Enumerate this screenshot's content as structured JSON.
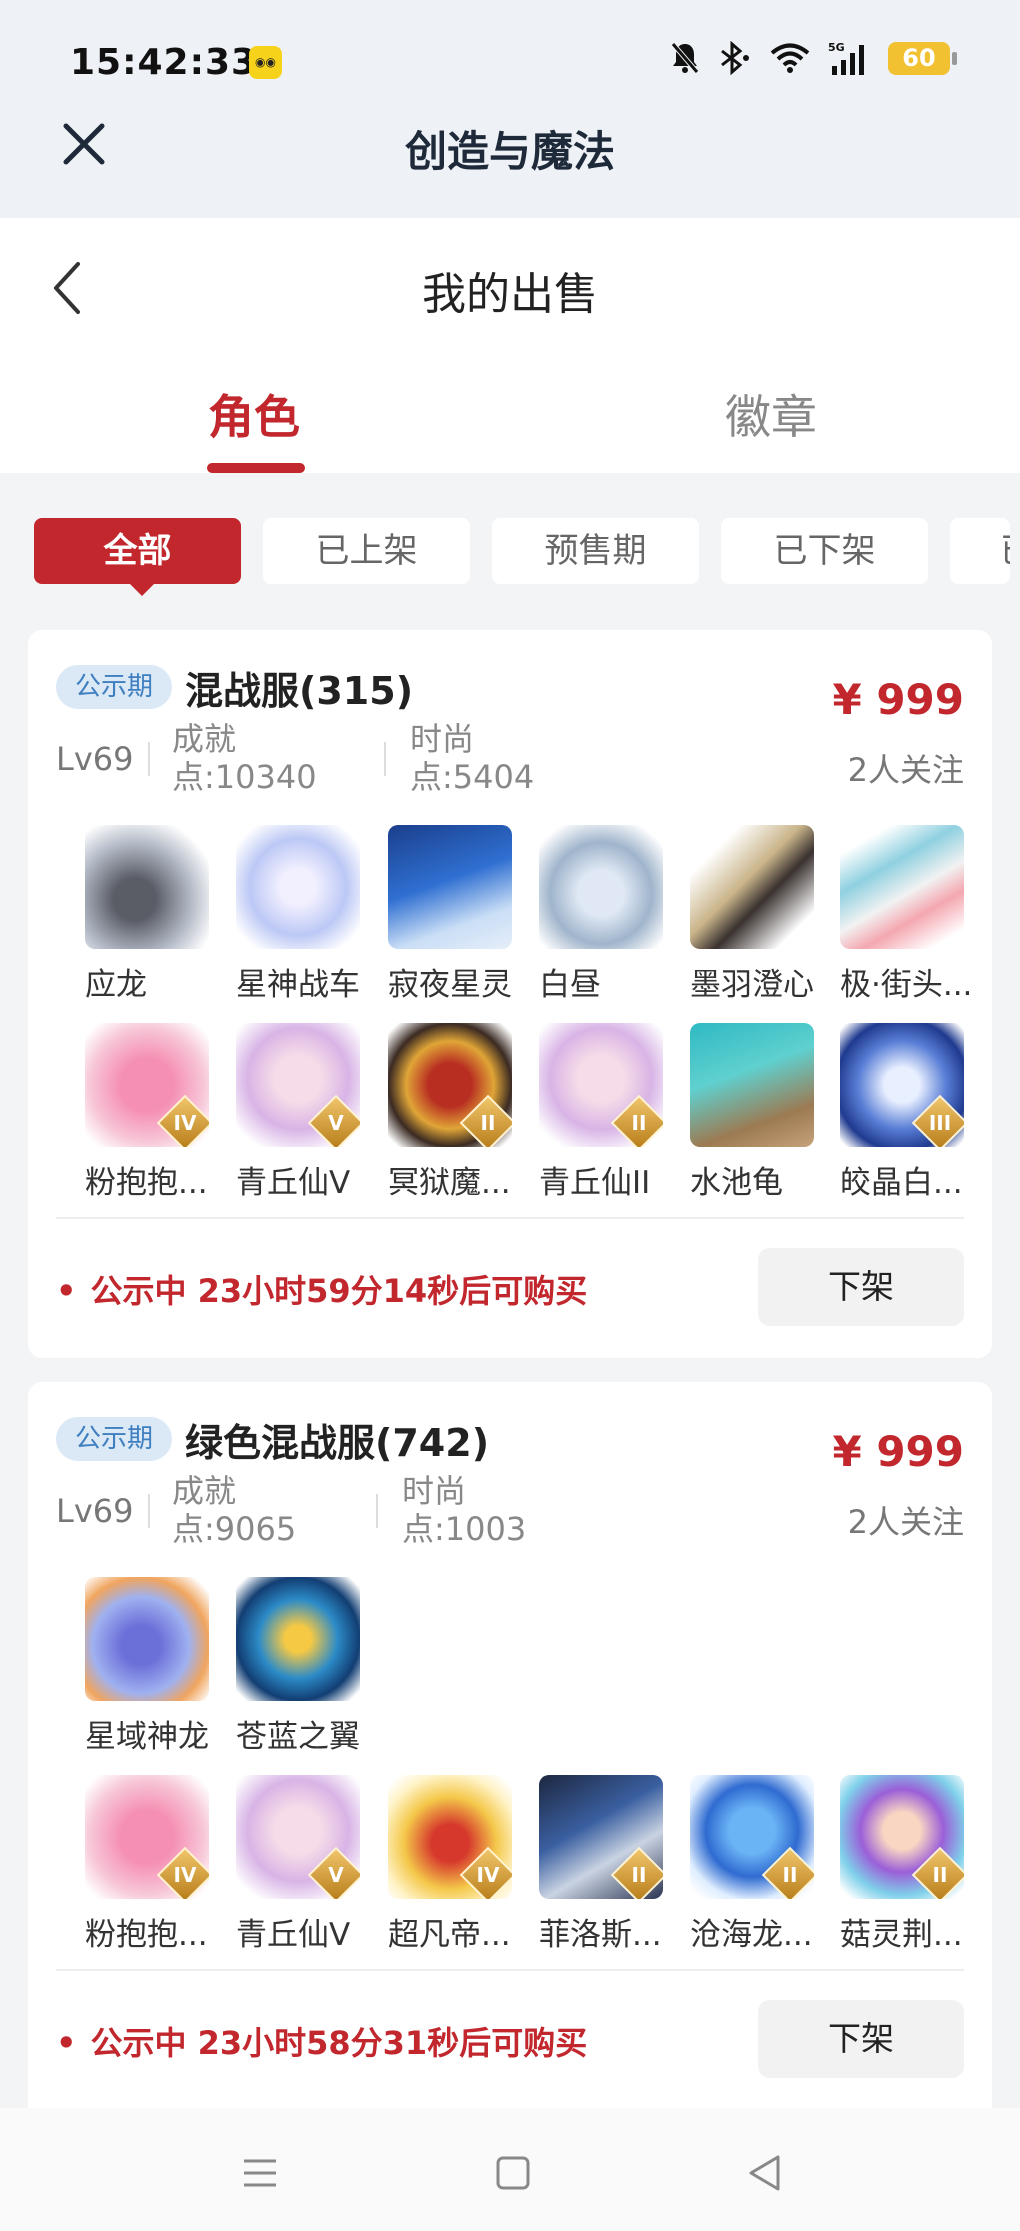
{
  "status_bar": {
    "time": "15:42:33",
    "app_icon": "app-notification-icon",
    "battery": "60"
  },
  "app_header": {
    "title": "创造与魔法"
  },
  "page": {
    "title": "我的出售"
  },
  "tabs": [
    {
      "label": "角色",
      "active": true
    },
    {
      "label": "徽章",
      "active": false
    }
  ],
  "filters": [
    {
      "label": "全部",
      "active": true
    },
    {
      "label": "已上架",
      "active": false
    },
    {
      "label": "预售期",
      "active": false
    },
    {
      "label": "已下架",
      "active": false
    },
    {
      "label": "已",
      "active": false
    }
  ],
  "listings": [
    {
      "badge": "公示期",
      "server": "混战服(315)",
      "price": "¥ 999",
      "followers": "2人关注",
      "level": "Lv69",
      "achievement_label": "成就",
      "achievement_value": "点:10340",
      "fashion_label": "时尚",
      "fashion_value": "点:5404",
      "row1": [
        {
          "name": "应龙"
        },
        {
          "name": "星神战车"
        },
        {
          "name": "寂夜星灵"
        },
        {
          "name": "白昼"
        },
        {
          "name": "墨羽澄心"
        },
        {
          "name": "极·街头..."
        }
      ],
      "row2": [
        {
          "name": "粉抱抱...",
          "tier": "IV"
        },
        {
          "name": "青丘仙V",
          "tier": "V"
        },
        {
          "name": "冥狱魔...",
          "tier": "II"
        },
        {
          "name": "青丘仙II",
          "tier": "II"
        },
        {
          "name": "水池龟"
        },
        {
          "name": "皎晶白...",
          "tier": "III"
        }
      ],
      "notice": "公示中 23小时59分14秒后可购买",
      "action": "下架"
    },
    {
      "badge": "公示期",
      "server": "绿色混战服(742)",
      "price": "¥ 999",
      "followers": "2人关注",
      "level": "Lv69",
      "achievement_label": "成就",
      "achievement_value": "点:9065",
      "fashion_label": "时尚",
      "fashion_value": "点:1003",
      "row1": [
        {
          "name": "星域神龙"
        },
        {
          "name": "苍蓝之翼"
        }
      ],
      "row2": [
        {
          "name": "粉抱抱...",
          "tier": "IV"
        },
        {
          "name": "青丘仙V",
          "tier": "V"
        },
        {
          "name": "超凡帝...",
          "tier": "IV"
        },
        {
          "name": "菲洛斯...",
          "tier": "II"
        },
        {
          "name": "沧海龙...",
          "tier": "II"
        },
        {
          "name": "菇灵荆...",
          "tier": "II"
        }
      ],
      "notice": "公示中 23小时58分31秒后可购买",
      "action": "下架"
    }
  ],
  "colors": {
    "accent": "#c1272d",
    "badge_bg": "#dbe9f7",
    "badge_text": "#3f7fc0"
  }
}
